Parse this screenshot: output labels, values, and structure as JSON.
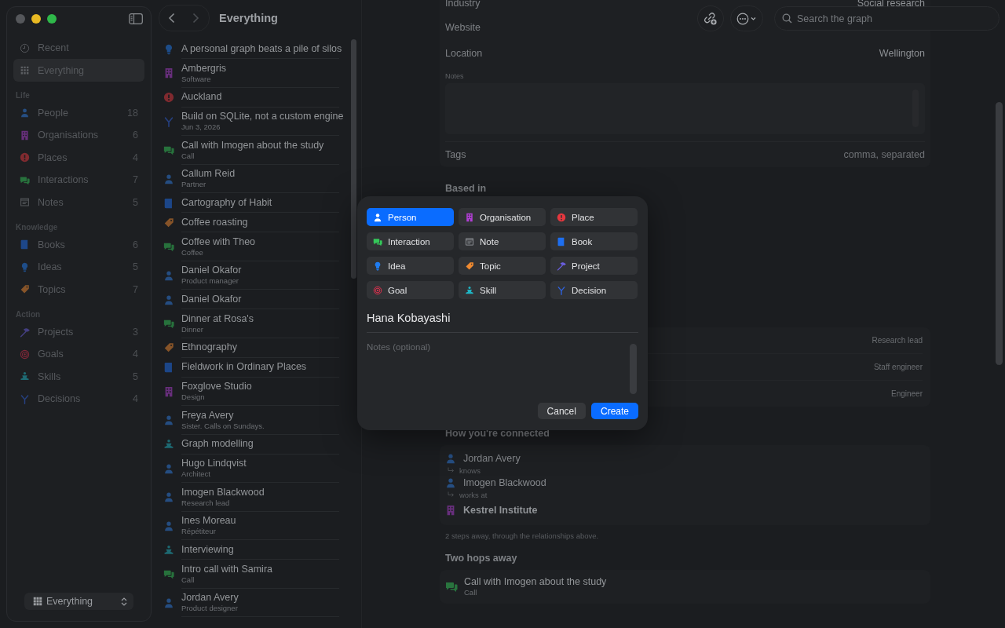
{
  "sidebar": {
    "items": [
      {
        "kind": "recent",
        "label": "Recent",
        "selected": false
      },
      {
        "kind": "everything",
        "label": "Everything",
        "selected": true
      }
    ],
    "sections": [
      {
        "title": "Life",
        "items": [
          {
            "kind": "person",
            "label": "People",
            "count": "18",
            "selected": false
          },
          {
            "kind": "org",
            "label": "Organisations",
            "count": "6",
            "selected": false
          },
          {
            "kind": "place",
            "label": "Places",
            "count": "4",
            "selected": false
          },
          {
            "kind": "interaction",
            "label": "Interactions",
            "count": "7",
            "selected": false
          },
          {
            "kind": "note",
            "label": "Notes",
            "count": "5",
            "selected": false
          }
        ]
      },
      {
        "title": "Knowledge",
        "items": [
          {
            "kind": "book",
            "label": "Books",
            "count": "6",
            "selected": false
          },
          {
            "kind": "idea",
            "label": "Ideas",
            "count": "5",
            "selected": false
          },
          {
            "kind": "topic",
            "label": "Topics",
            "count": "7",
            "selected": false
          }
        ]
      },
      {
        "title": "Action",
        "items": [
          {
            "kind": "project",
            "label": "Projects",
            "count": "3",
            "selected": false
          },
          {
            "kind": "goal",
            "label": "Goals",
            "count": "4",
            "selected": false
          },
          {
            "kind": "skill",
            "label": "Skills",
            "count": "5",
            "selected": false
          },
          {
            "kind": "decision",
            "label": "Decisions",
            "count": "4",
            "selected": false
          }
        ]
      }
    ],
    "scope_button": {
      "label": "Everything"
    }
  },
  "list": {
    "title": "Everything",
    "rows": [
      {
        "kind": "idea",
        "title": "A personal graph beats a pile of silos"
      },
      {
        "kind": "org",
        "title": "Ambergris",
        "subtitle": "Software"
      },
      {
        "kind": "place",
        "title": "Auckland"
      },
      {
        "kind": "decision",
        "title": "Build on SQLite, not a custom engine",
        "subtitle": "Jun 3, 2026"
      },
      {
        "kind": "interaction",
        "title": "Call with Imogen about the study",
        "subtitle": "Call"
      },
      {
        "kind": "person",
        "title": "Callum Reid",
        "subtitle": "Partner"
      },
      {
        "kind": "book",
        "title": "Cartography of Habit"
      },
      {
        "kind": "topic",
        "title": "Coffee roasting"
      },
      {
        "kind": "interaction",
        "title": "Coffee with Theo",
        "subtitle": "Coffee"
      },
      {
        "kind": "person",
        "title": "Daniel Okafor",
        "subtitle": "Product manager"
      },
      {
        "kind": "person",
        "title": "Daniel Okafor"
      },
      {
        "kind": "interaction",
        "title": "Dinner at Rosa's",
        "subtitle": "Dinner"
      },
      {
        "kind": "topic",
        "title": "Ethnography"
      },
      {
        "kind": "book",
        "title": "Fieldwork in Ordinary Places"
      },
      {
        "kind": "org",
        "title": "Foxglove Studio",
        "subtitle": "Design"
      },
      {
        "kind": "person",
        "title": "Freya Avery",
        "subtitle": "Sister. Calls on Sundays."
      },
      {
        "kind": "skill",
        "title": "Graph modelling"
      },
      {
        "kind": "person",
        "title": "Hugo Lindqvist",
        "subtitle": "Architect"
      },
      {
        "kind": "person",
        "title": "Imogen Blackwood",
        "subtitle": "Research lead"
      },
      {
        "kind": "person",
        "title": "Ines Moreau",
        "subtitle": "Répétiteur"
      },
      {
        "kind": "skill",
        "title": "Interviewing"
      },
      {
        "kind": "interaction",
        "title": "Intro call with Samira",
        "subtitle": "Call"
      },
      {
        "kind": "person",
        "title": "Jordan Avery",
        "subtitle": "Product designer"
      }
    ]
  },
  "toolbar": {
    "search": {
      "placeholder": "Search the graph"
    }
  },
  "detail": {
    "fields": [
      {
        "label": "Industry",
        "value": "Social research"
      },
      {
        "label": "Website"
      },
      {
        "label": "Location",
        "value": "Wellington"
      }
    ],
    "notes_label": "Notes",
    "tags": {
      "label": "Tags",
      "placeholder": "comma, separated"
    },
    "based_in": {
      "heading": "Based in"
    },
    "related_rows": [
      {
        "detail": "Research lead"
      },
      {
        "detail": "Staff engineer"
      },
      {
        "detail": "Engineer"
      }
    ],
    "connection": {
      "heading": "How you're connected",
      "path": [
        {
          "kind": "person",
          "name": "Jordan Avery",
          "relation": "knows"
        },
        {
          "kind": "person",
          "name": "Imogen Blackwood",
          "relation": "works at"
        },
        {
          "kind": "org",
          "name": "Kestrel Institute"
        }
      ],
      "note": "2 steps away, through the relationships above."
    },
    "two_hops": {
      "heading": "Two hops away",
      "items": [
        {
          "kind": "interaction",
          "title": "Call with Imogen about the study",
          "subtitle": "Call"
        }
      ]
    }
  },
  "dialog": {
    "types": [
      {
        "kind": "person",
        "label": "Person",
        "selected": true
      },
      {
        "kind": "org",
        "label": "Organisation",
        "selected": false
      },
      {
        "kind": "place",
        "label": "Place",
        "selected": false
      },
      {
        "kind": "interaction",
        "label": "Interaction",
        "selected": false
      },
      {
        "kind": "note",
        "label": "Note",
        "selected": false
      },
      {
        "kind": "book",
        "label": "Book",
        "selected": false
      },
      {
        "kind": "idea",
        "label": "Idea",
        "selected": false
      },
      {
        "kind": "topic",
        "label": "Topic",
        "selected": false
      },
      {
        "kind": "project",
        "label": "Project",
        "selected": false
      },
      {
        "kind": "goal",
        "label": "Goal",
        "selected": false
      },
      {
        "kind": "skill",
        "label": "Skill",
        "selected": false
      },
      {
        "kind": "decision",
        "label": "Decision",
        "selected": false
      }
    ],
    "name": {
      "value": "Hana Kobayashi"
    },
    "notes": {
      "placeholder": "Notes (optional)"
    },
    "buttons": [
      {
        "kind": "cancel",
        "label": "Cancel"
      },
      {
        "kind": "primary",
        "label": "Create"
      }
    ]
  }
}
